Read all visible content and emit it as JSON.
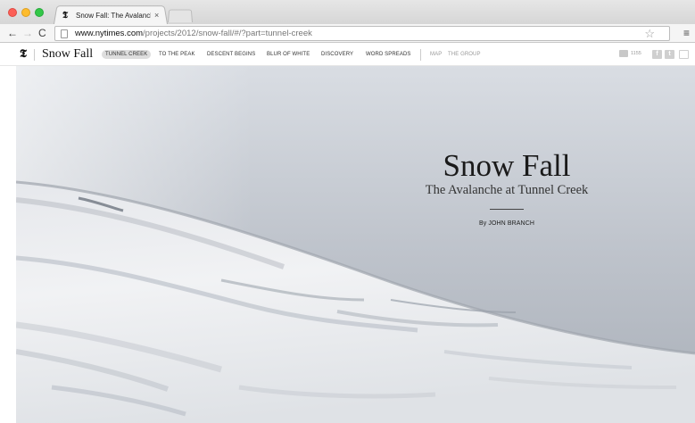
{
  "browser": {
    "tab": {
      "favicon": "𝕿",
      "title": "Snow Fall: The Avalanche a",
      "close": "×"
    },
    "toolbar": {
      "back": "←",
      "forward": "→",
      "reload": "C",
      "url_host": "www.nytimes.com",
      "url_path": "/projects/2012/snow-fall/#/?part=tunnel-creek",
      "bookmark": "☆",
      "menu": "≡"
    }
  },
  "site": {
    "logo": "𝕿",
    "title": "Snow Fall",
    "chapters": [
      {
        "label": "TUNNEL CREEK",
        "active": true
      },
      {
        "label": "TO THE PEAK"
      },
      {
        "label": "DESCENT BEGINS"
      },
      {
        "label": "BLUR OF WHITE"
      },
      {
        "label": "DISCOVERY"
      },
      {
        "label": "WORD SPREADS"
      }
    ],
    "extras": [
      {
        "label": "MAP"
      },
      {
        "label": "THE GROUP"
      }
    ],
    "comment_count": "1155",
    "social": {
      "facebook": "f",
      "twitter": "t"
    }
  },
  "hero": {
    "title": "Snow Fall",
    "subtitle": "The Avalanche at Tunnel Creek",
    "byline": "By JOHN BRANCH"
  },
  "colors": {
    "tl_red": "#fc5f57",
    "tl_yellow": "#fdbc2e",
    "tl_green": "#33c748",
    "active_chapter_bg": "#dddddd"
  }
}
